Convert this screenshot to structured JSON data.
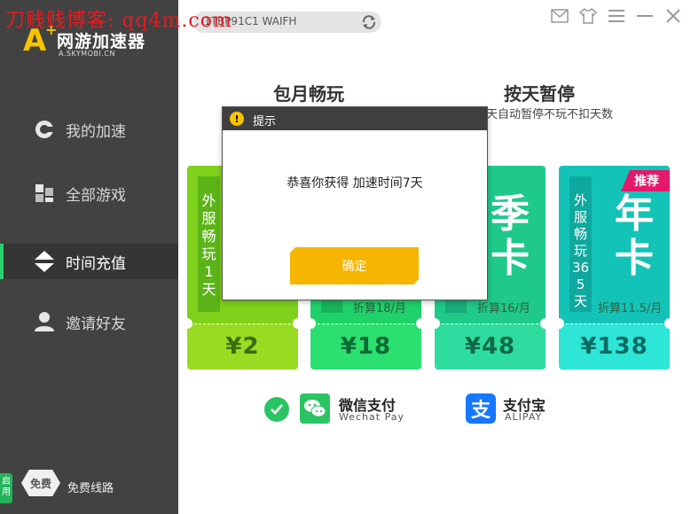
{
  "watermark": "刀贱贱博客: qq4m.com",
  "logo": {
    "mark": "A",
    "plus": "+",
    "name": "网游加速器",
    "url": "A.SKYMOBI.CN"
  },
  "account": {
    "text": "1TBP91C1 WAIFH"
  },
  "sidebar": {
    "items": [
      {
        "label": "我的加速",
        "icon": "speed-gauge-icon"
      },
      {
        "label": "全部游戏",
        "icon": "grid-icon"
      },
      {
        "label": "时间充值",
        "icon": "updown-arrows-icon",
        "active": true
      },
      {
        "label": "邀请好友",
        "icon": "user-icon"
      }
    ],
    "free": {
      "tag": "启用",
      "badge": "免费",
      "label": "免费线路"
    }
  },
  "plans": {
    "monthly": {
      "title": "包月畅玩"
    },
    "daily": {
      "title": "按天暂停",
      "subtitle": "天自动暂停不玩不扣天数"
    }
  },
  "cards": [
    {
      "vertical": "外服畅玩1天",
      "price": "¥2",
      "colors": {
        "top": "#7fd11c",
        "bar": "#5cb418",
        "bottom": "#99db22",
        "price": "#3b6e0c"
      }
    },
    {
      "big": "",
      "discount": "折算18/月",
      "price": "¥18",
      "colors": {
        "top": "#1fd16a",
        "bar": "#16b35a",
        "bottom": "#2be070",
        "price": "#0e6a34"
      }
    },
    {
      "big": "季卡",
      "discount": "折算16/月",
      "price": "¥48",
      "colors": {
        "top": "#1ec98a",
        "bar": "#17ac78",
        "bottom": "#2fdc9f",
        "price": "#0e6a4a"
      }
    },
    {
      "vertical": "外服畅玩365天",
      "big": "年卡",
      "discount": "折算11.5/月",
      "badge": "推荐",
      "price": "¥138",
      "colors": {
        "top": "#14c3b8",
        "bar": "#0fa89f",
        "bottom": "#2de6d8",
        "price": "#0c6a63"
      }
    }
  ],
  "payment": {
    "wechat": {
      "name": "微信支付",
      "en": "Wechat Pay"
    },
    "alipay": {
      "name": "支付宝",
      "en": "ALIPAY",
      "glyph": "支"
    }
  },
  "dialog": {
    "title": "提示",
    "message": "恭喜你获得 加速时间7天",
    "ok_label": "确定"
  }
}
